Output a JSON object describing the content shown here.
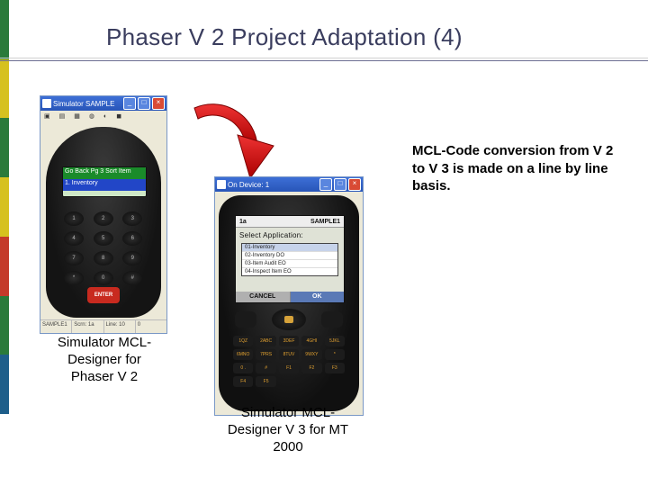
{
  "title": "Phaser V 2 Project Adaptation (4)",
  "colorbar": [
    "#2a7a3a",
    "#d6c11f",
    "#2a7a3a",
    "#d6c11f",
    "#c43a2a",
    "#2a7a3a",
    "#1e5e8a"
  ],
  "sim_v2": {
    "window_title": "Simulator SAMPLE",
    "screen_line1": "Go Back  Pg 3 Sort Item",
    "screen_line2": "1. Inventory",
    "keys": [
      "1",
      "2",
      "3",
      "4",
      "5",
      "6",
      "7",
      "8",
      "9",
      "*",
      "0",
      "#"
    ],
    "enter_label": "ENTER",
    "status": [
      "SAMPLE1",
      "Scrn: 1a",
      "Line: 10",
      "0"
    ]
  },
  "sim_v3": {
    "window_title": "On Device: 1",
    "screen_top_left": "1a",
    "screen_top_right": "SAMPLE1",
    "screen_header": "Select Application:",
    "list": [
      "01-Inventory",
      "02-Inventory DO",
      "03-Item Audit EO",
      "04-Inspect Item EO"
    ],
    "soft_left": "CANCEL",
    "soft_right": "OK",
    "keys_row": [
      "1QZ",
      "2ABC",
      "3DEF",
      "4GHI",
      "5JKL",
      "6MNO",
      "7PRS",
      "8TUV",
      "9WXY",
      "*",
      "0 .",
      "#",
      "F1",
      "F2",
      "F3",
      "F4",
      "F5"
    ]
  },
  "caption_v2": "Simulator MCL-Designer for Phaser V 2",
  "caption_v3": "Simulator MCL-Designer V 3 for MT 2000",
  "description": "MCL-Code conversion from V 2 to V 3 is made on a line by line basis.",
  "arrow_color": "#cc1a12"
}
